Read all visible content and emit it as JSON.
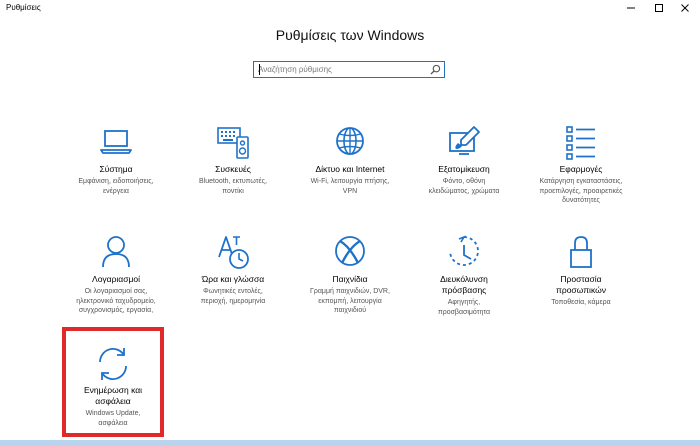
{
  "window": {
    "title": "Ρυθμίσεις",
    "controls": [
      "minimize-icon",
      "maximize-icon",
      "close-icon"
    ]
  },
  "header": {
    "title": "Ρυθμίσεις των Windows"
  },
  "search": {
    "placeholder": "Αναζήτηση ρύθμισης",
    "value": "",
    "icon": "search-icon"
  },
  "colors": {
    "accent": "#1f72c9",
    "highlight": "#e02a2a"
  },
  "tiles": [
    {
      "id": "system",
      "icon": "laptop-icon",
      "label": "Σύστημα",
      "desc": "Εμφάνιση, ειδοποιήσεις,\nενέργεια"
    },
    {
      "id": "devices",
      "icon": "devices-icon",
      "label": "Συσκευές",
      "desc": "Bluetooth, εκτυπωτές,\nποντίκι"
    },
    {
      "id": "network",
      "icon": "globe-icon",
      "label": "Δίκτυο και Internet",
      "desc": "Wi-Fi, λειτουργία πτήσης,\nVPN"
    },
    {
      "id": "personalization",
      "icon": "paint-brush-icon",
      "label": "Εξατομίκευση",
      "desc": "Φόντο, οθόνη\nκλειδώματος, χρώματα"
    },
    {
      "id": "apps",
      "icon": "apps-list-icon",
      "label": "Εφαρμογές",
      "desc": "Κατάργηση εγκαταστάσεις,\nπροεπιλογές, προαιρετικές\nδυνατότητες"
    },
    {
      "id": "accounts",
      "icon": "person-icon",
      "label": "Λογαριασμοί",
      "desc": "Οι λογαριασμοί σας,\nηλεκτρονικό ταχυδρομείο,\nσυγχρονισμός, εργασία,"
    },
    {
      "id": "time-language",
      "icon": "time-language-icon",
      "label": "Ώρα και γλώσσα",
      "desc": "Φωνητικές εντολές,\nπεριοχή, ημερομηνία"
    },
    {
      "id": "gaming",
      "icon": "xbox-icon",
      "label": "Παιχνίδια",
      "desc": "Γραμμή παιχνιδιών, DVR,\nεκπομπή, λειτουργία\nπαιχνιδιού"
    },
    {
      "id": "ease-of-access",
      "icon": "ease-of-access-icon",
      "label": "Διευκόλυνση\nπρόσβασης",
      "desc": "Αφηγητής,\nπροσβασιμότητα"
    },
    {
      "id": "privacy",
      "icon": "lock-icon",
      "label": "Προστασία\nπροσωπικών",
      "desc": "Τοποθεσία, κάμερα"
    },
    {
      "id": "update-security",
      "icon": "sync-icon",
      "label": "Ενημέρωση και\nασφάλεια",
      "desc": "Windows Update,\nασφάλεια"
    }
  ]
}
